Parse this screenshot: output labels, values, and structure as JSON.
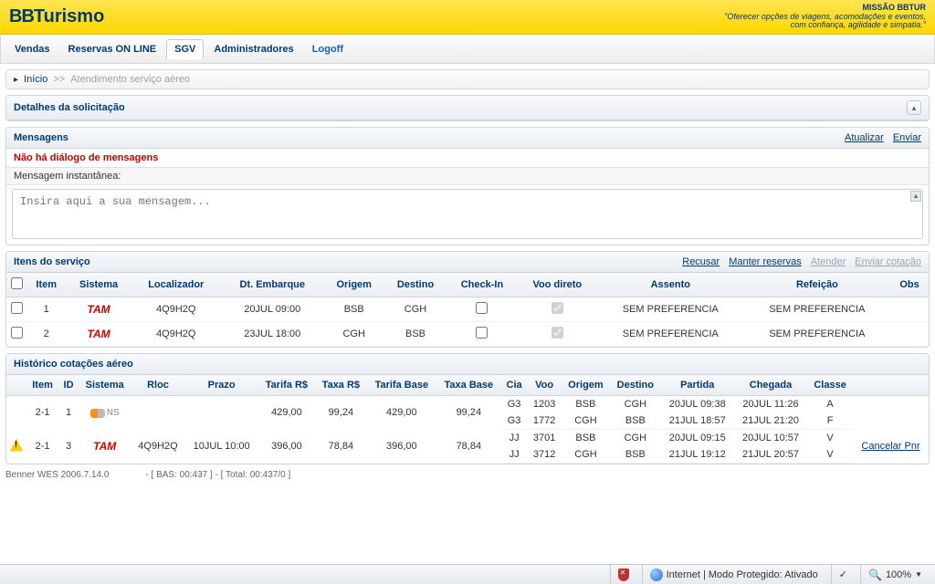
{
  "header": {
    "logo_bb": "BB",
    "logo_rest": "Turismo",
    "mission_title": "MISSÃO BBTUR",
    "mission_line1": "\"Oferecer opções de viagens, acomodações e eventos,",
    "mission_line2": "com confiança, agilidade e simpatia.\""
  },
  "menu": {
    "vendas": "Vendas",
    "reservas": "Reservas ON LINE",
    "sgv": "SGV",
    "admins": "Administradores",
    "logoff": "Logoff"
  },
  "breadcrumb": {
    "inicio": "Início",
    "sep": ">>",
    "current": "Atendimento serviço aéreo"
  },
  "panels": {
    "detalhes": "Detalhes da solicitação",
    "mensagens": "Mensagens",
    "itens": "Itens do serviço",
    "historico": "Histórico cotações aéreo"
  },
  "msg": {
    "actions": {
      "atualizar": "Atualizar",
      "enviar": "Enviar"
    },
    "alert": "Não há diálogo de mensagens",
    "label": "Mensagem instantânea:",
    "placeholder": "Insira aqui a sua mensagem..."
  },
  "itens_actions": {
    "recusar": "Recusar",
    "manter": "Manter reservas",
    "atender": "Atender",
    "enviar_cot": "Enviar cotação"
  },
  "itens_headers": {
    "chk": "",
    "item": "Item",
    "sistema": "Sistema",
    "loc": "Localizador",
    "dt": "Dt. Embarque",
    "origem": "Origem",
    "destino": "Destino",
    "checkin": "Check-In",
    "voo_direto": "Voo direto",
    "assento": "Assento",
    "refeicao": "Refeição",
    "obs": "Obs"
  },
  "itens_rows": [
    {
      "item": "1",
      "sistema": "TAM",
      "loc": "4Q9H2Q",
      "dt": "20JUL 09:00",
      "origem": "BSB",
      "destino": "CGH",
      "checkin": false,
      "voo_direto": true,
      "assento": "SEM PREFERENCIA",
      "refeicao": "SEM PREFERENCIA",
      "obs": ""
    },
    {
      "item": "2",
      "sistema": "TAM",
      "loc": "4Q9H2Q",
      "dt": "23JUL 18:00",
      "origem": "CGH",
      "destino": "BSB",
      "checkin": false,
      "voo_direto": true,
      "assento": "SEM PREFERENCIA",
      "refeicao": "SEM PREFERENCIA",
      "obs": ""
    }
  ],
  "hist_headers": {
    "warn": "",
    "item": "Item",
    "id": "ID",
    "sistema": "Sistema",
    "rloc": "Rloc",
    "prazo": "Prazo",
    "tarifa": "Tarifa R$",
    "taxa": "Taxa R$",
    "tarifa_base": "Tarifa Base",
    "taxa_base": "Taxa Base",
    "cia": "Cia",
    "voo": "Voo",
    "origem": "Origem",
    "destino": "Destino",
    "partida": "Partida",
    "chegada": "Chegada",
    "classe": "Classe",
    "act": ""
  },
  "hist_rows": [
    {
      "warn": false,
      "item": "2-1",
      "id": "1",
      "sistema": "GOL",
      "rloc": "",
      "prazo": "",
      "tarifa": "429,00",
      "taxa": "99,24",
      "tarifa_base": "429,00",
      "taxa_base": "99,24",
      "legs": [
        {
          "cia": "G3",
          "voo": "1203",
          "origem": "BSB",
          "destino": "CGH",
          "partida": "20JUL 09:38",
          "chegada": "20JUL 11:26",
          "classe": "A"
        },
        {
          "cia": "G3",
          "voo": "1772",
          "origem": "CGH",
          "destino": "BSB",
          "partida": "21JUL 18:57",
          "chegada": "21JUL 21:20",
          "classe": "F"
        }
      ],
      "action": ""
    },
    {
      "warn": true,
      "item": "2-1",
      "id": "3",
      "sistema": "TAM",
      "rloc": "4Q9H2Q",
      "prazo": "10JUL 10:00",
      "tarifa": "396,00",
      "taxa": "78,84",
      "tarifa_base": "396,00",
      "taxa_base": "78,84",
      "legs": [
        {
          "cia": "JJ",
          "voo": "3701",
          "origem": "BSB",
          "destino": "CGH",
          "partida": "20JUL 09:15",
          "chegada": "20JUL 10:57",
          "classe": "V"
        },
        {
          "cia": "JJ",
          "voo": "3712",
          "origem": "CGH",
          "destino": "BSB",
          "partida": "21JUL 19:12",
          "chegada": "21JUL 20:57",
          "classe": "V"
        }
      ],
      "action": "Cancelar Pnr"
    }
  ],
  "footer": {
    "left": "Benner WES 2006.7.14.0",
    "right": "- [ BAS: 00:437 ] - [ Total: 00:437/0 ]"
  },
  "ie": {
    "zone": "Internet | Modo Protegido: Ativado",
    "zoom": "100%"
  }
}
